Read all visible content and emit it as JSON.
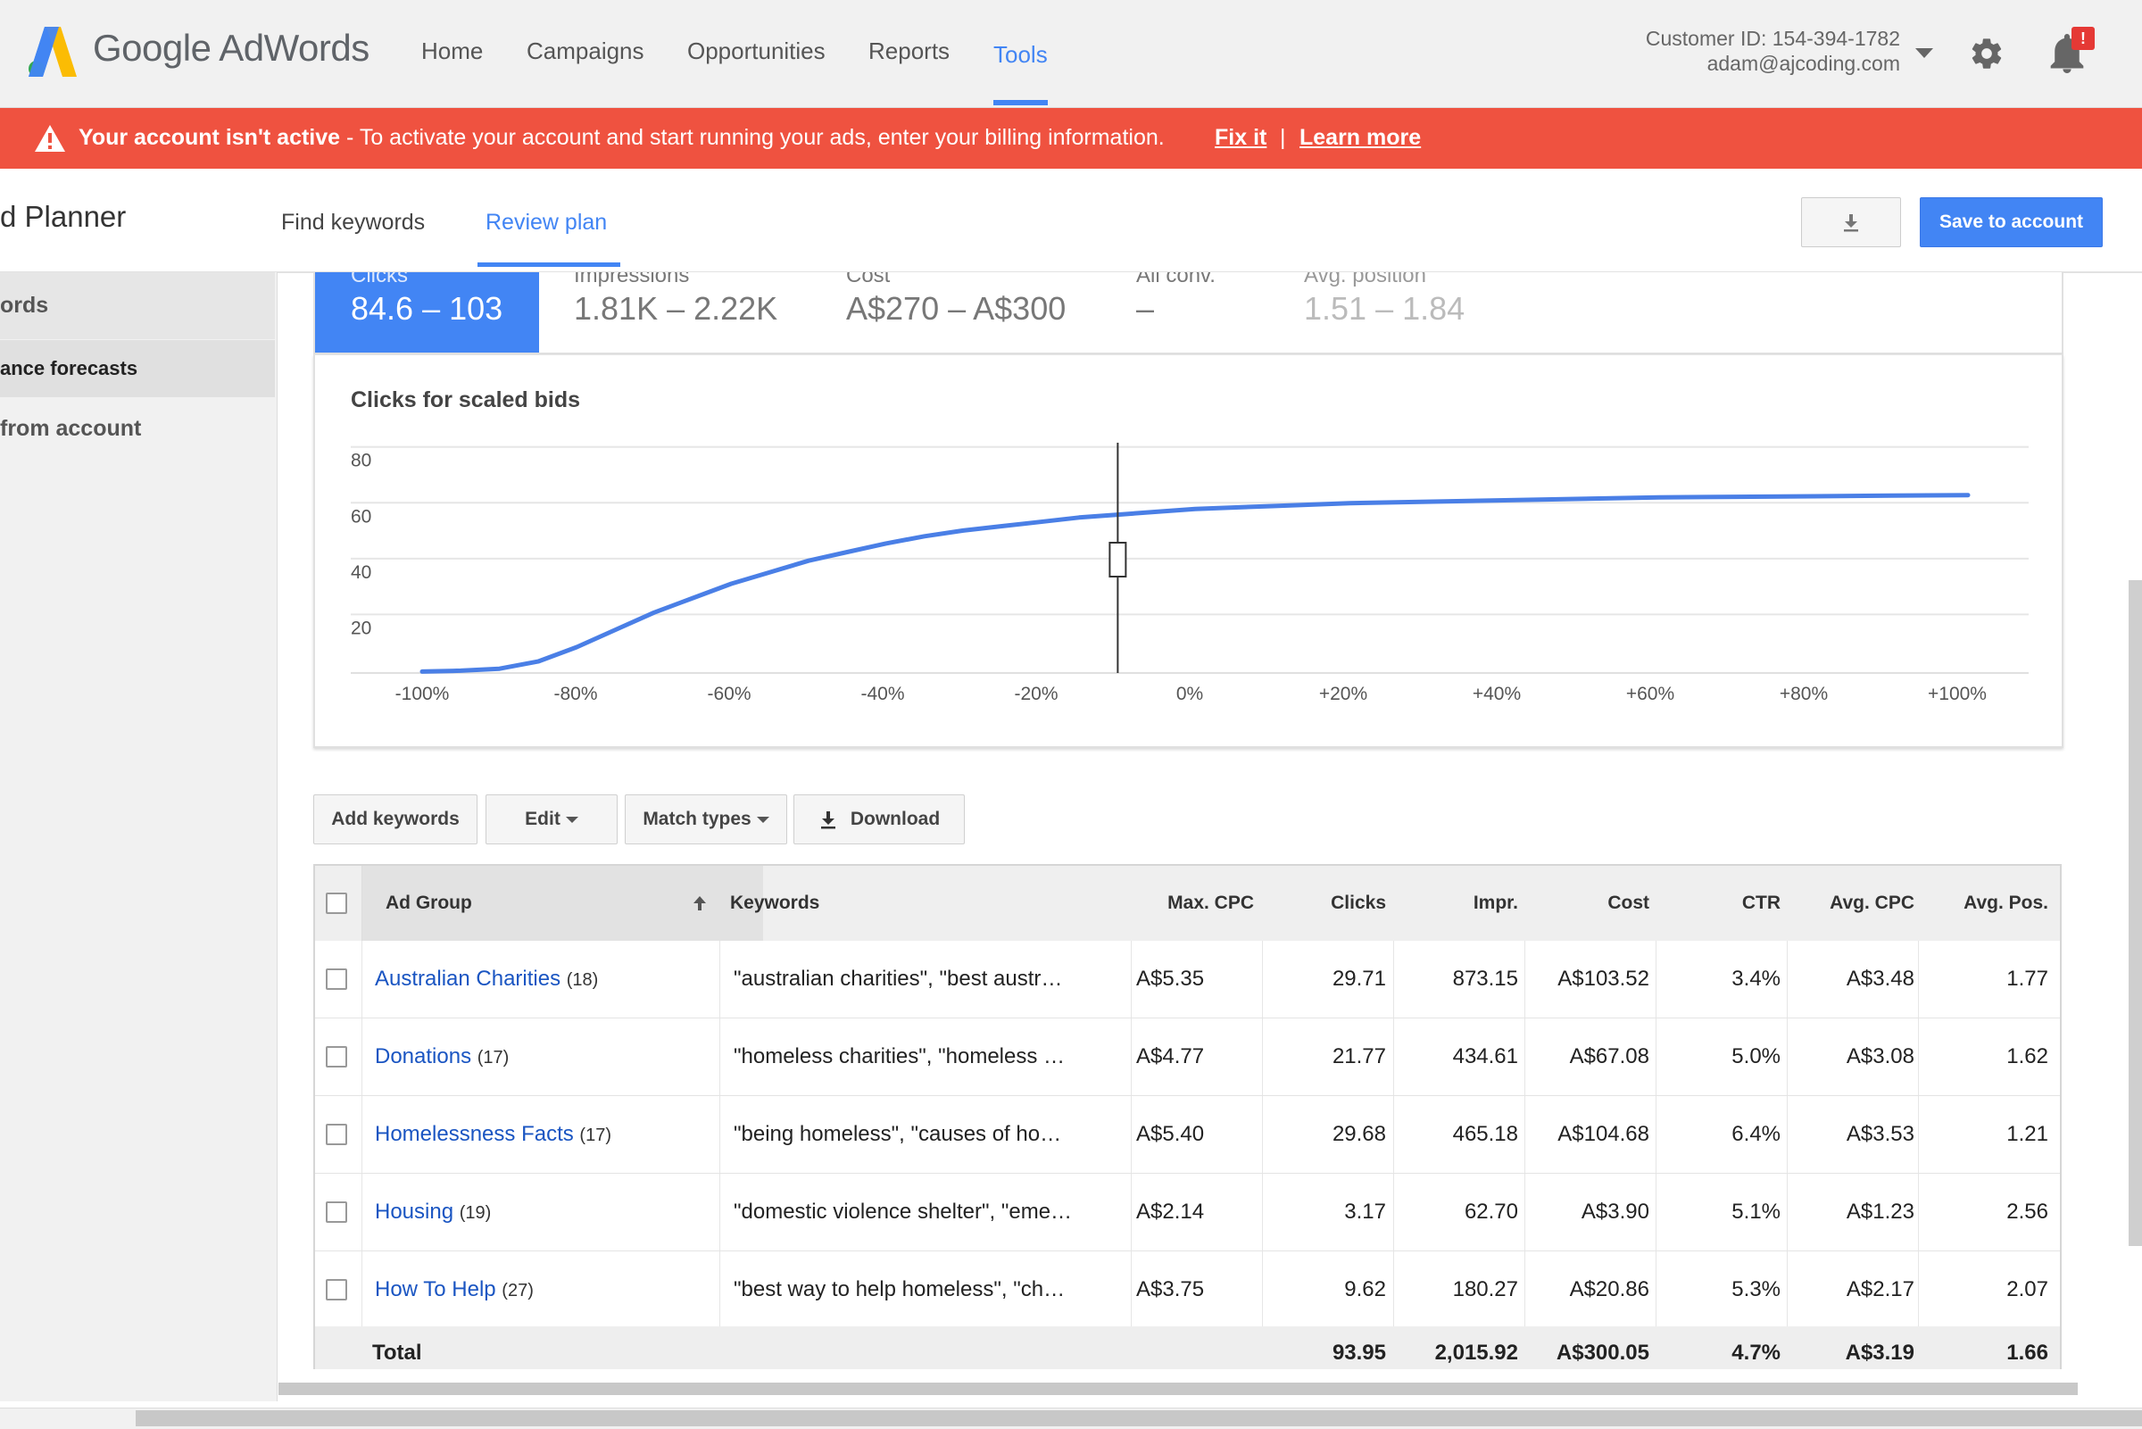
{
  "header": {
    "logo_text": "Google AdWords",
    "nav": [
      "Home",
      "Campaigns",
      "Opportunities",
      "Reports",
      "Tools"
    ],
    "active_nav": "Tools",
    "customer_id": "Customer ID: 154-394-1782",
    "email": "adam@ajcoding.com",
    "notification_badge": "!"
  },
  "alert": {
    "title": "Your account isn't active",
    "message": " - To activate your account and start running your ads, enter your billing information. ",
    "fix_link": "Fix it",
    "separator": "|",
    "learn_link": "Learn more",
    "color": "#ef5240"
  },
  "planner": {
    "title": "d Planner",
    "tabs": [
      "Find keywords",
      "Review plan"
    ],
    "active_tab": "Review plan",
    "save_label": "Save to account"
  },
  "sidebar": {
    "items": [
      "ords",
      "ance forecasts",
      " from account"
    ]
  },
  "metrics": [
    {
      "label": "Clicks",
      "value": "84.6 – 103"
    },
    {
      "label": "Impressions",
      "value": "1.81K – 2.22K"
    },
    {
      "label": "Cost",
      "value": "A$270 – A$300"
    },
    {
      "label": "All conv.",
      "value": "–"
    },
    {
      "label": "Avg. position",
      "value": "1.51 – 1.84"
    }
  ],
  "chart_data": {
    "type": "line",
    "title": "Clicks for scaled bids",
    "x_tick_labels": [
      "-100%",
      "-80%",
      "-60%",
      "-40%",
      "-20%",
      "0%",
      "+20%",
      "+40%",
      "+60%",
      "+80%",
      "+100%"
    ],
    "y_tick_labels": [
      "80",
      "60",
      "40",
      "20"
    ],
    "ylim": [
      0,
      80
    ],
    "x": [
      -100,
      -95,
      -90,
      -85,
      -80,
      -75,
      -70,
      -65,
      -60,
      -55,
      -50,
      -45,
      -40,
      -35,
      -30,
      -25,
      -20,
      -15,
      -10,
      -5,
      0,
      10,
      20,
      30,
      40,
      50,
      60,
      70,
      80,
      90,
      100
    ],
    "values": [
      0.5,
      0.8,
      1.5,
      4,
      9,
      15,
      21,
      26,
      31,
      35,
      39,
      42,
      45,
      47.5,
      49.5,
      51,
      52.5,
      54,
      55,
      56,
      57,
      58,
      59,
      59.5,
      60,
      60.5,
      61,
      61.2,
      61.4,
      61.6,
      61.8
    ],
    "marker_x": -10,
    "line_color": "#4a7fe6",
    "grid": true
  },
  "toolbar": {
    "add_keywords": "Add keywords",
    "edit": "Edit",
    "match_types": "Match types",
    "download": "Download"
  },
  "table": {
    "headers": [
      "Ad Group",
      "Keywords",
      "Max. CPC",
      "Clicks",
      "Impr.",
      "Cost",
      "CTR",
      "Avg. CPC",
      "Avg. Pos."
    ],
    "rows": [
      {
        "ad_group": "Australian Charities",
        "count": "(18)",
        "keywords": "\"australian charities\", \"best austr…",
        "max_cpc": "A$5.35",
        "clicks": "29.71",
        "impr": "873.15",
        "cost": "A$103.52",
        "ctr": "3.4%",
        "avg_cpc": "A$3.48",
        "avg_pos": "1.77"
      },
      {
        "ad_group": "Donations",
        "count": "(17)",
        "keywords": "\"homeless charities\", \"homeless …",
        "max_cpc": "A$4.77",
        "clicks": "21.77",
        "impr": "434.61",
        "cost": "A$67.08",
        "ctr": "5.0%",
        "avg_cpc": "A$3.08",
        "avg_pos": "1.62"
      },
      {
        "ad_group": "Homelessness Facts",
        "count": "(17)",
        "keywords": "\"being homeless\", \"causes of ho…",
        "max_cpc": "A$5.40",
        "clicks": "29.68",
        "impr": "465.18",
        "cost": "A$104.68",
        "ctr": "6.4%",
        "avg_cpc": "A$3.53",
        "avg_pos": "1.21"
      },
      {
        "ad_group": "Housing",
        "count": "(19)",
        "keywords": "\"domestic violence shelter\", \"eme…",
        "max_cpc": "A$2.14",
        "clicks": "3.17",
        "impr": "62.70",
        "cost": "A$3.90",
        "ctr": "5.1%",
        "avg_cpc": "A$1.23",
        "avg_pos": "2.56"
      },
      {
        "ad_group": "How To Help",
        "count": "(27)",
        "keywords": "\"best way to help homeless\", \"ch…",
        "max_cpc": "A$3.75",
        "clicks": "9.62",
        "impr": "180.27",
        "cost": "A$20.86",
        "ctr": "5.3%",
        "avg_cpc": "A$2.17",
        "avg_pos": "2.07"
      }
    ],
    "total": {
      "label": "Total",
      "clicks": "93.95",
      "impr": "2,015.92",
      "cost": "A$300.05",
      "ctr": "4.7%",
      "avg_cpc": "A$3.19",
      "avg_pos": "1.66"
    }
  },
  "colors": {
    "accent": "#4285f4",
    "link": "#1a55c2",
    "alert": "#ef5240"
  }
}
